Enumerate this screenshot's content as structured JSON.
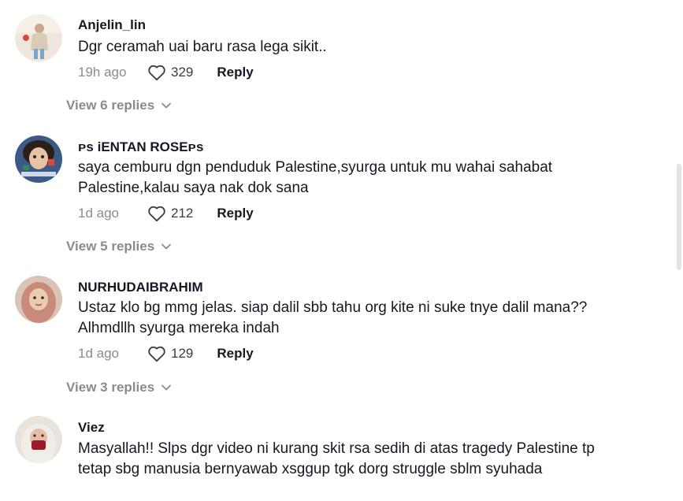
{
  "comments": [
    {
      "username": "Anjelin_lin",
      "text": "Dgr ceramah uai baru rasa lega sikit..",
      "time": "19h ago",
      "likes": "329",
      "reply_label": "Reply",
      "view_replies": "View 6 replies"
    },
    {
      "username": "ᴘs iENTAN ROSEᴘs",
      "text": "saya cemburu dgn penduduk Palestine,syurga untuk mu wahai sahabat Palestine,kalau saya nak dok sana",
      "time": "1d ago",
      "likes": "212",
      "reply_label": "Reply",
      "view_replies": "View 5 replies"
    },
    {
      "username": "NURHUDAIBRAHIM",
      "text": "Ustaz klo bg mmg jelas. siap dalil sbb tahu org kite ni suke tnye dalil mana?? Alhmdllh syurga mereka indah",
      "time": "1d ago",
      "likes": "129",
      "reply_label": "Reply",
      "view_replies": "View 3 replies"
    },
    {
      "username": "Viez",
      "text": "Masyallah!! Slps dgr video ni kurang skit rsa sedih di atas tragedy Palestine tp tetap sbg manusia bernyawab xsggup tgk dorg struggle sblm syuhada"
    }
  ],
  "icons": {
    "like": "heart-outline-icon",
    "expand": "chevron-down-icon"
  },
  "colors": {
    "text_primary": "#161823",
    "text_secondary": "#8a8b91"
  }
}
